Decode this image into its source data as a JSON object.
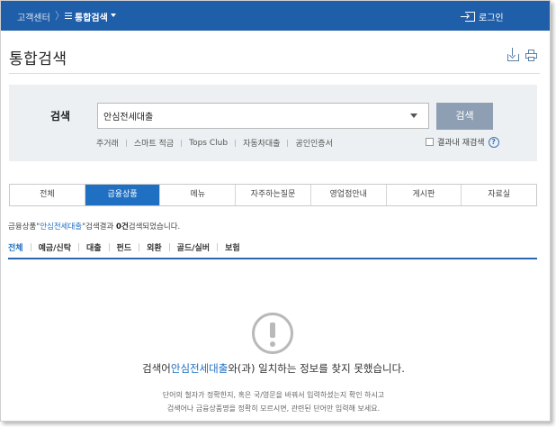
{
  "header": {
    "breadcrumb_home": "고객센터",
    "breadcrumb_separator": "〉",
    "breadcrumb_current": "통합검색",
    "login_label": "로그인"
  },
  "page": {
    "title": "통합검색"
  },
  "search": {
    "label": "검색",
    "value": "안심전세대출",
    "button_label": "검색",
    "keywords": [
      "주거래",
      "스마트 적금",
      "Tops Club",
      "자동차대출",
      "공인인증서"
    ],
    "research_label": "결과내 재검색",
    "help_symbol": "?"
  },
  "tabs": [
    {
      "label": "전체",
      "active": false
    },
    {
      "label": "금융상품",
      "active": true
    },
    {
      "label": "메뉴",
      "active": false
    },
    {
      "label": "자주하는질문",
      "active": false
    },
    {
      "label": "영업점안내",
      "active": false
    },
    {
      "label": "게시판",
      "active": false
    },
    {
      "label": "자료실",
      "active": false
    }
  ],
  "result": {
    "category": "금융상품",
    "open_quote": "\"",
    "keyword": "안심전세대출",
    "close_quote_suffix": "\"검색결과 ",
    "count": "0건",
    "suffix": "검색되었습니다."
  },
  "subtabs": [
    {
      "label": "전체",
      "active": true
    },
    {
      "label": "예금/신탁",
      "active": false
    },
    {
      "label": "대출",
      "active": false
    },
    {
      "label": "펀드",
      "active": false
    },
    {
      "label": "외환",
      "active": false
    },
    {
      "label": "골드/실버",
      "active": false
    },
    {
      "label": "보험",
      "active": false
    }
  ],
  "empty_state": {
    "prefix": "검색어",
    "keyword": "안심전세대출",
    "suffix": "와(과) 일치하는 정보를 찾지 못했습니다.",
    "desc_line1": "단어의 철자가 정확한지, 혹은 국/영문을 바꿔서 입력하셨는지 확인 하시고",
    "desc_line2": "검색어나 금융상품명을 정확히 모르시면, 관련된 단어만 입력해 보세요."
  },
  "colors": {
    "header_blue": "#1f5ea8",
    "accent_blue": "#1f6fc2",
    "search_button": "#8e9fb4",
    "panel_bg": "#ecf0f3"
  }
}
